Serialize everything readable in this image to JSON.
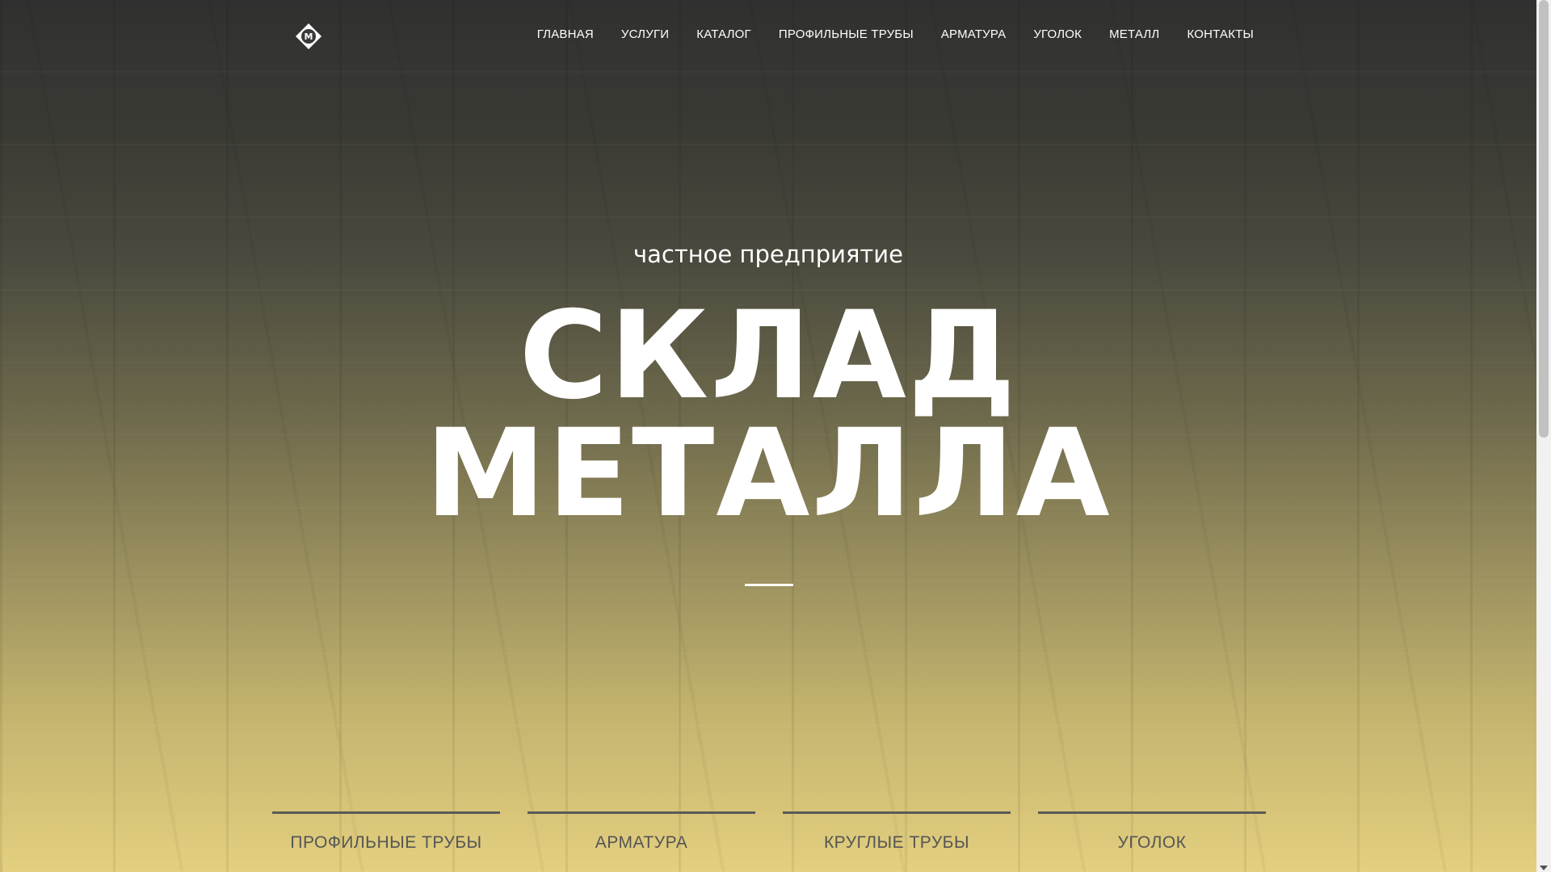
{
  "header": {
    "logo_icon": "logo-m-diamond-icon",
    "nav": [
      {
        "label": "ГЛАВНАЯ"
      },
      {
        "label": "УСЛУГИ"
      },
      {
        "label": "КАТАЛОГ"
      },
      {
        "label": "ПРОФИЛЬНЫЕ ТРУБЫ"
      },
      {
        "label": "АРМАТУРА"
      },
      {
        "label": "УГОЛОК"
      },
      {
        "label": "МЕТАЛЛ"
      },
      {
        "label": "КОНТАКТЫ"
      }
    ]
  },
  "hero": {
    "subtitle": "частное предприятие",
    "title_line1": "СКЛАД",
    "title_line2": "МЕТАЛЛА"
  },
  "categories": [
    {
      "label": "ПРОФИЛЬНЫЕ ТРУБЫ"
    },
    {
      "label": "АРМАТУРА"
    },
    {
      "label": "КРУГЛЫЕ ТРУБЫ"
    },
    {
      "label": "УГОЛОК"
    }
  ],
  "colors": {
    "background_top": "#303030",
    "background_bottom": "#e3cf7f",
    "text_light": "#ffffff",
    "category_text": "#555555"
  }
}
